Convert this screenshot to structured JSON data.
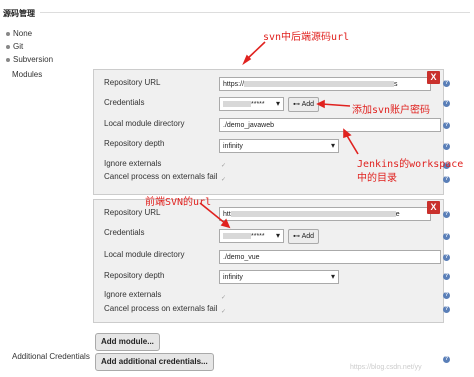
{
  "section": {
    "title": "源码管理"
  },
  "scm_options": [
    {
      "label": "None"
    },
    {
      "label": "Git"
    },
    {
      "label": "Subversion"
    }
  ],
  "modules_label": "Modules",
  "additional_credentials_label": "Additional Credentials",
  "module1": {
    "repo_url_label": "Repository URL",
    "repo_url_value_start": "https://",
    "repo_url_value_end": "s",
    "credentials_label": "Credentials",
    "credentials_value": "*****",
    "add_label": "Add",
    "local_dir_label": "Local module directory",
    "local_dir_value": "./demo_javaweb",
    "depth_label": "Repository depth",
    "depth_value": "infinity",
    "ignore_label": "Ignore externals",
    "cancel_label": "Cancel process on externals fail",
    "close_label": "X"
  },
  "module2": {
    "repo_url_label": "Repository URL",
    "repo_url_value_start": "htt",
    "repo_url_value_end": "e",
    "credentials_label": "Credentials",
    "credentials_value": "*****",
    "add_label": "Add",
    "local_dir_label": "Local module directory",
    "local_dir_value": "./demo_vue",
    "depth_label": "Repository depth",
    "depth_value": "infinity",
    "ignore_label": "Ignore externals",
    "cancel_label": "Cancel process on externals fail",
    "close_label": "X"
  },
  "add_module_label": "Add module...",
  "add_credentials_label": "Add additional credentials...",
  "annotations": {
    "backend_url": "svn中后端源码url",
    "svn_account": "添加svn账户密码",
    "workspace_line1": "Jenkins的workspace",
    "workspace_line2": "中的目录",
    "frontend_url": "前端SVN的url"
  },
  "watermark": "https://blog.csdn.net/yy",
  "colors": {
    "annotation": "#e0221f",
    "close_button": "#c9302c",
    "help_icon": "#5a7fb8"
  }
}
